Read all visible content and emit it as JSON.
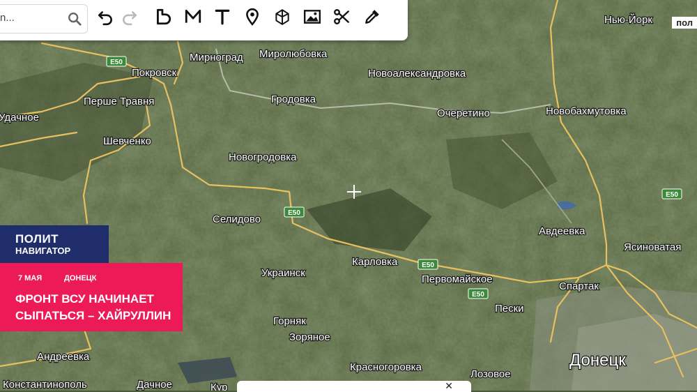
{
  "search": {
    "placeholder": "n..."
  },
  "toolbar": {
    "tools": [
      "undo-icon",
      "redo-icon",
      "polygon-icon",
      "polyline-icon",
      "text-icon",
      "pin-icon",
      "3d-box-icon",
      "image-icon",
      "scissors-icon",
      "eyedropper-icon"
    ]
  },
  "map": {
    "labels": {
      "mirnograd": "Мирноград",
      "mirolyubovka": "Миролюбовка",
      "new_york": "Нью-Йорк",
      "pokrovsk": "Покровск",
      "novoaleksandrovka": "Новоалександровка",
      "udachnoe": "Удачное",
      "pershe_travnya": "Перше Травня",
      "grodovka": "Гродовка",
      "ocheretino": "Очеретино",
      "novobakhmutovka": "Новобахмутовка",
      "shevchenko": "Шевченко",
      "novogrodovka": "Новогродовка",
      "selidovo": "Селидово",
      "avdeevka": "Авдеевка",
      "yasinovataya": "Ясиноватая",
      "ukrainsk": "Украинск",
      "karlovka": "Карловка",
      "pervomayskoe": "Первомайское",
      "spartak": "Спартак",
      "peski": "Пески",
      "gornyak": "Горняк",
      "zoryanoe": "Зоряное",
      "donetsk": "Донецк",
      "andreevka": "Андреевка",
      "krasnogorovka": "Красногоровка",
      "lozovoe": "Лозовое",
      "konstantinopol": "Константинополь",
      "dachnoe": "Дачное",
      "kura": "Кур"
    },
    "road_route": "E50",
    "corner_label": "пол"
  },
  "news": {
    "logo_line1": "ПОЛИТ",
    "logo_line2": "НАВИГАТОР",
    "date": "7 МАЯ",
    "place": "ДОНЕЦК",
    "headline_line1": "ФРОНТ ВСУ НАЧИНАЕТ",
    "headline_line2": "СЫПАТЬСЯ – ХАЙРУЛЛИН"
  },
  "bottom_panel": {
    "close_label": "✕"
  },
  "colors": {
    "road": "#e8c060",
    "banner": "#ec1b57",
    "logo_bg": "#1f2d6b",
    "label_text": "#ffffff"
  }
}
